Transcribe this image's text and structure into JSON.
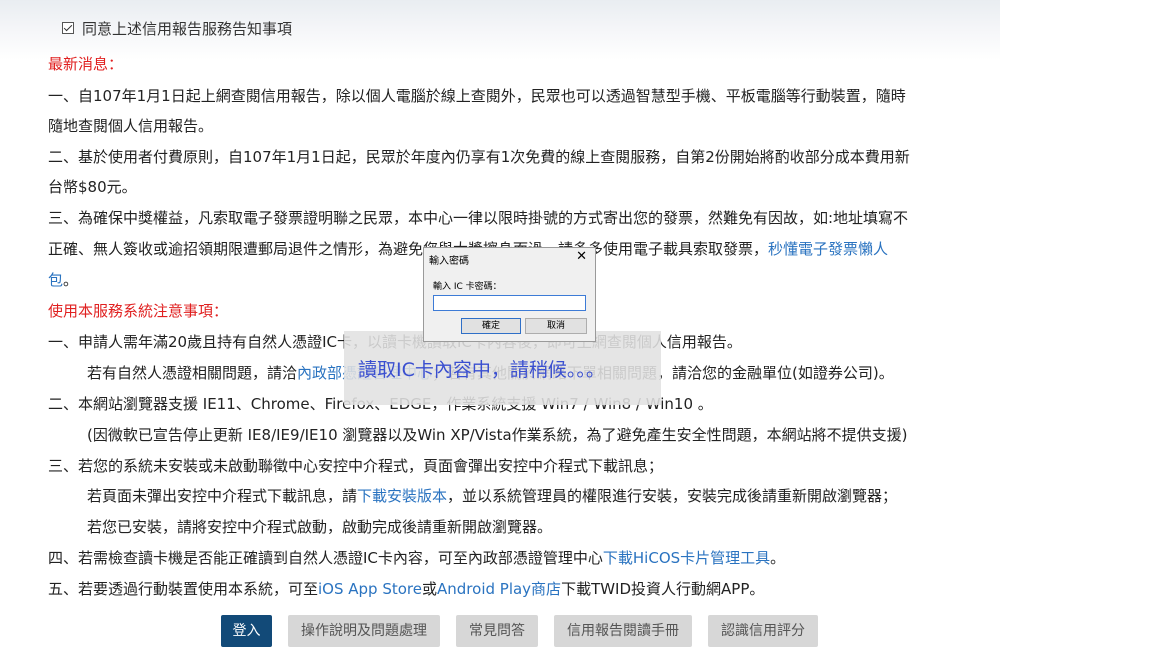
{
  "agree": {
    "label": "同意上述信用報告服務告知事項"
  },
  "news": {
    "heading": "最新消息：",
    "l1a": "一、自107年1月1日起上網查閱信用報告，除以個人電腦於線上查閱外，民眾也可以透過智慧型手機、平板電腦等行動裝置，隨時",
    "l1b": "隨地查閱個人信用報告。",
    "l2a": "二、基於使用者付費原則，自107年1月1日起，民眾於年度內仍享有1次免費的線上查閱服務，自第2份開始將酌收部分成本費用新",
    "l2b": "台幣$80元。",
    "l3a": "三、為確保中獎權益，凡索取電子發票證明聯之民眾，本中心一律以限時掛號的方式寄出您的發票，然難免有因故，如:地址填寫不",
    "l3b_text": "正確、無人簽收或逾招領期限遭郵局退件之情形，為避免您與大獎擦身而過，請多多使用電子載具索取發票，",
    "l3b_link": "秒懂電子發票懶人",
    "l3c_link": "包",
    "l3c_text": "。"
  },
  "notice": {
    "heading": "使用本服務系統注意事項：",
    "l1": "一、申請人需年滿20歲且持有自然人憑證IC卡，以讀卡機讀取IC卡內容後，即可上網查閱個人信用報告。",
    "l1b_text1": "若有自然人憑證相關問題，請洽",
    "l1b_link": "內政部憑證管理中心",
    "l1b_text2": "；若有其他關於網路下單相關問題，請洽您的金融單位(如證券公司)。",
    "l2": "二、本網站瀏覽器支援 IE11、Chrome、Firefox、EDGE，作業系統支援 Win7 / Win8 / Win10 。",
    "l2b": "(因微軟已宣告停止更新 IE8/IE9/IE10 瀏覽器以及Win XP/Vista作業系統，為了避免產生安全性問題，本網站將不提供支援)",
    "l3": "三、若您的系統未安裝或未啟動聯徵中心安控中介程式，頁面會彈出安控中介程式下載訊息；",
    "l3b_text1": "若頁面未彈出安控中介程式下載訊息，請",
    "l3b_link": "下載安裝版本",
    "l3b_text2": "，並以系統管理員的權限進行安裝，安裝完成後請重新開啟瀏覽器；",
    "l3c": "若您已安裝，請將安控中介程式啟動，啟動完成後請重新開啟瀏覽器。",
    "l4_text1": "四、若需檢查讀卡機是否能正確讀到自然人憑證IC卡內容，可至內政部憑證管理中心",
    "l4_link": "下載HiCOS卡片管理工具",
    "l4_text2": "。",
    "l5_text1": "五、若要透過行動裝置使用本系統，可至",
    "l5_link1": "iOS App Store",
    "l5_text2": "或",
    "l5_link2": "Android Play商店",
    "l5_text3": "下載TWID投資人行動網APP。"
  },
  "buttons": {
    "login": "登入",
    "help": "操作說明及問題處理",
    "faq": "常見問答",
    "manual": "信用報告閱讀手冊",
    "score": "認識信用評分"
  },
  "loading": {
    "text": "讀取IC卡內容中，請稍候。。。"
  },
  "dialog": {
    "title": "輸入密碼",
    "close": "✕",
    "label": "輸入 IC 卡密碼：",
    "input_value": "",
    "ok": "確定",
    "cancel": "取消"
  }
}
